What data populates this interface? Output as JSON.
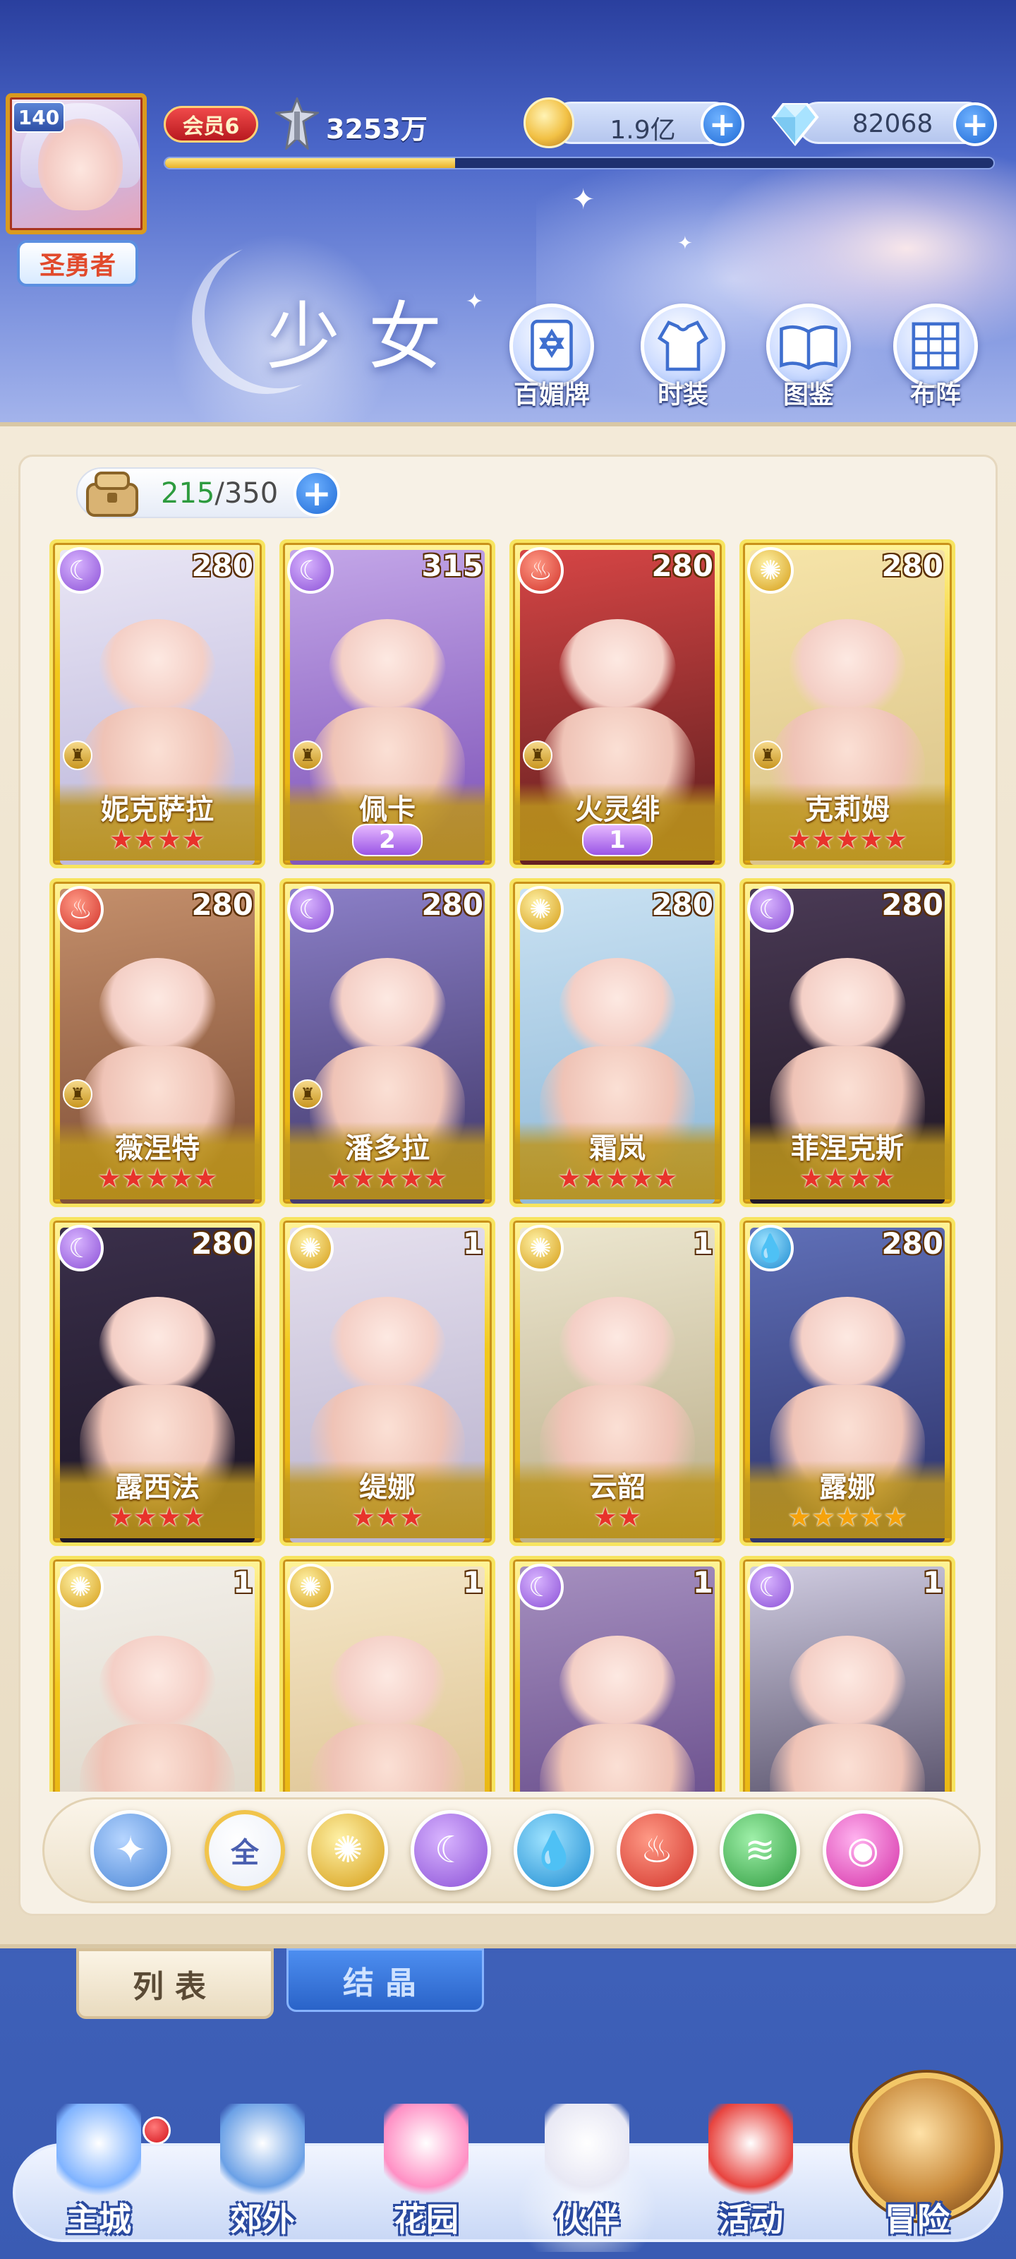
{
  "header": {
    "player_level": "140",
    "player_title": "圣勇者",
    "vip_label": "会员6",
    "combat_power": "3253万",
    "exp_progress": 0.35,
    "gold": "1.9亿",
    "diamonds": "82068",
    "section_title": "少女",
    "features": [
      {
        "label": "百媚牌",
        "icon": "card-icon"
      },
      {
        "label": "时装",
        "icon": "costume-icon"
      },
      {
        "label": "图鉴",
        "icon": "book-icon"
      },
      {
        "label": "布阵",
        "icon": "formation-grid-icon"
      }
    ]
  },
  "bag": {
    "current": "215",
    "max": "/350"
  },
  "heroes": [
    {
      "name": "妮克萨拉",
      "level": "280",
      "element": "moon",
      "stars": 4,
      "wing": null,
      "role": true
    },
    {
      "name": "佩卡",
      "level": "315",
      "element": "moon",
      "stars": 0,
      "wing": "2",
      "role": true
    },
    {
      "name": "火灵绯",
      "level": "280",
      "element": "fire",
      "stars": 0,
      "wing": "1",
      "role": true
    },
    {
      "name": "克莉姆",
      "level": "280",
      "element": "sun",
      "stars": 5,
      "wing": null,
      "role": true
    },
    {
      "name": "薇涅特",
      "level": "280",
      "element": "fire",
      "stars": 5,
      "wing": null,
      "role": true
    },
    {
      "name": "潘多拉",
      "level": "280",
      "element": "moon",
      "stars": 5,
      "wing": null,
      "role": true
    },
    {
      "name": "霜岚",
      "level": "280",
      "element": "sun",
      "stars": 5,
      "wing": null,
      "role": false
    },
    {
      "name": "菲涅克斯",
      "level": "280",
      "element": "moon",
      "stars": 4,
      "wing": null,
      "role": false
    },
    {
      "name": "露西法",
      "level": "280",
      "element": "moon",
      "stars": 4,
      "wing": null,
      "role": false
    },
    {
      "name": "缇娜",
      "level": "1",
      "element": "sun",
      "stars": 3,
      "wing": null,
      "role": false
    },
    {
      "name": "云韶",
      "level": "1",
      "element": "sun",
      "stars": 2,
      "wing": null,
      "role": false
    },
    {
      "name": "露娜",
      "level": "280",
      "element": "water",
      "stars": 5,
      "wing": null,
      "role": false,
      "gold_stars": true
    },
    {
      "name": "",
      "level": "1",
      "element": "sun",
      "stars": 0,
      "wing": null,
      "role": false
    },
    {
      "name": "",
      "level": "1",
      "element": "sun",
      "stars": 0,
      "wing": null,
      "role": false
    },
    {
      "name": "",
      "level": "1",
      "element": "moon",
      "stars": 0,
      "wing": null,
      "role": false
    },
    {
      "name": "",
      "level": "1",
      "element": "moon",
      "stars": 0,
      "wing": null,
      "role": false
    }
  ],
  "filters": [
    {
      "name": "collapse",
      "label": "",
      "icon": "collapse-arrow-icon"
    },
    {
      "name": "all",
      "label": "全",
      "icon": ""
    },
    {
      "name": "sun",
      "label": "",
      "icon": "sun-element-icon"
    },
    {
      "name": "moon",
      "label": "",
      "icon": "moon-element-icon"
    },
    {
      "name": "water",
      "label": "",
      "icon": "water-element-icon"
    },
    {
      "name": "fire",
      "label": "",
      "icon": "fire-element-icon"
    },
    {
      "name": "wind",
      "label": "",
      "icon": "wind-element-icon"
    },
    {
      "name": "pink",
      "label": "",
      "icon": "orb-element-icon"
    }
  ],
  "tabs": {
    "list": "列表",
    "crystal": "结晶"
  },
  "nav": [
    {
      "label": "主城",
      "icon": "castle-icon"
    },
    {
      "label": "郊外",
      "icon": "portal-icon"
    },
    {
      "label": "花园",
      "icon": "heart-garden-icon"
    },
    {
      "label": "伙伴",
      "icon": "partner-icon"
    },
    {
      "label": "活动",
      "icon": "gift-icon"
    },
    {
      "label": "冒险",
      "icon": "compass-icon"
    }
  ],
  "colors": {
    "card_gold": "#f2c91c",
    "star_red": "#e8332b",
    "accent_blue": "#1f6ad6"
  }
}
